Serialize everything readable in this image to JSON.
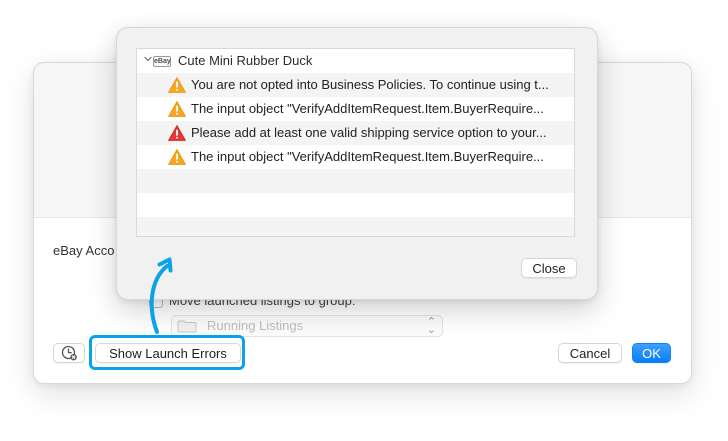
{
  "background_window": {
    "account_label": "eBay Acco",
    "move_launched_label": "Move launched listings to group:",
    "group_select_value": "Running Listings",
    "updown_icon": "chevron-updown-icon",
    "launch_history_icon": "history-clock-icon",
    "show_errors_label": "Show Launch Errors",
    "cancel_label": "Cancel",
    "ok_label": "OK"
  },
  "sheet": {
    "group": {
      "label": "Cute Mini Rubber Duck",
      "expanded": true,
      "icon": "ebay-icon"
    },
    "errors": [
      {
        "severity": "warning",
        "icon": "warning-triangle-icon",
        "text": "You are not opted into Business Policies. To continue using t..."
      },
      {
        "severity": "warning",
        "icon": "warning-triangle-icon",
        "text": "The input object \"VerifyAddItemRequest.Item.BuyerRequire..."
      },
      {
        "severity": "error",
        "icon": "error-triangle-icon",
        "text": "Please add at least one valid shipping service option to your..."
      },
      {
        "severity": "warning",
        "icon": "warning-triangle-icon",
        "text": "The input object \"VerifyAddItemRequest.Item.BuyerRequire..."
      }
    ],
    "close_label": "Close"
  },
  "annotation": {
    "highlight_color": "#0aa3e8",
    "arrow_icon": "curved-arrow-icon"
  },
  "colors": {
    "accent": "#0a84ff",
    "warning": "#f5a623",
    "error": "#e53935"
  }
}
